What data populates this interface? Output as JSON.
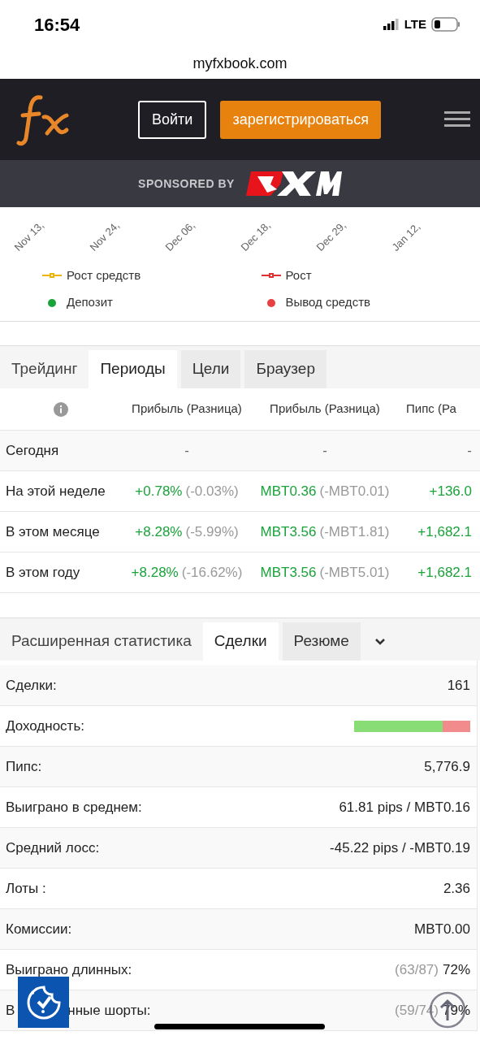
{
  "status_bar": {
    "time": "16:54",
    "network": "LTE"
  },
  "browser": {
    "url": "myfxbook.com"
  },
  "header": {
    "login": "Войти",
    "register": "зарегистрироваться"
  },
  "sponsor": {
    "label": "SPONSORED BY"
  },
  "chart": {
    "x_labels": [
      "Nov 13,",
      "Nov 24,",
      "Dec 06,",
      "Dec 18,",
      "Dec 29,",
      "Jan 12,"
    ],
    "legend": [
      {
        "label": "Рост средств",
        "kind": "line",
        "color": "#f0b400"
      },
      {
        "label": "Рост",
        "kind": "line",
        "color": "#e03030"
      },
      {
        "label": "Депозит",
        "kind": "dot",
        "color": "#1aa33a"
      },
      {
        "label": "Вывод средств",
        "kind": "dot",
        "color": "#e84040"
      }
    ]
  },
  "tabs": [
    {
      "label": "Трейдинг",
      "selected": false,
      "kind": "plain"
    },
    {
      "label": "Периоды",
      "selected": true,
      "kind": "box"
    },
    {
      "label": "Цели",
      "selected": false,
      "kind": "box"
    },
    {
      "label": "Браузер",
      "selected": false,
      "kind": "box"
    }
  ],
  "periods": {
    "columns": [
      "Прибыль (Разница)",
      "Прибыль (Разница)",
      "Пипс (Ра"
    ],
    "rows": [
      {
        "label": "Сегодня",
        "cells": [
          {
            "value": "-"
          },
          {
            "value": "-"
          },
          {
            "value": "-"
          }
        ]
      },
      {
        "label": "На этой неделе",
        "cells": [
          {
            "value": "+0.78%",
            "diff": "(-0.03%)"
          },
          {
            "value": "MBT0.36",
            "diff": "(-MBT0.01)"
          },
          {
            "value": "+136.0"
          }
        ]
      },
      {
        "label": "В этом месяце",
        "cells": [
          {
            "value": "+8.28%",
            "diff": "(-5.99%)"
          },
          {
            "value": "MBT3.56",
            "diff": "(-MBT1.81)"
          },
          {
            "value": "+1,682.1"
          }
        ]
      },
      {
        "label": "В этом году",
        "cells": [
          {
            "value": "+8.28%",
            "diff": "(-16.62%)"
          },
          {
            "value": "MBT3.56",
            "diff": "(-MBT5.01)"
          },
          {
            "value": "+1,682.1"
          }
        ]
      }
    ]
  },
  "stats_tabs": [
    {
      "label": "Расширенная статистика",
      "selected": false,
      "kind": "plain"
    },
    {
      "label": "Сделки",
      "selected": true,
      "kind": "box"
    },
    {
      "label": "Резюме",
      "selected": false,
      "kind": "box"
    }
  ],
  "stats": [
    {
      "label": "Сделки:",
      "kind": "text",
      "value": "161"
    },
    {
      "label": "Доходность:",
      "kind": "bar",
      "level": 0.76
    },
    {
      "label": "Пипс:",
      "kind": "text",
      "value": "5,776.9"
    },
    {
      "label": "Выиграно в среднем:",
      "kind": "text",
      "value": "61.81 pips / MBT0.16"
    },
    {
      "label": "Средний лосс:",
      "kind": "text",
      "value": "-45.22 pips / -MBT0.19"
    },
    {
      "label": "Лоты :",
      "kind": "text",
      "value": "2.36"
    },
    {
      "label": "Комиссии:",
      "kind": "text",
      "value": "MBT0.00"
    },
    {
      "label": "Выиграно длинных:",
      "kind": "ratio",
      "note": "(63/87)",
      "value": "72%"
    },
    {
      "label_parts": [
        "В",
        "нные шорты:"
      ],
      "kind": "ratio",
      "note": "(59/74)",
      "value": "79%"
    }
  ]
}
